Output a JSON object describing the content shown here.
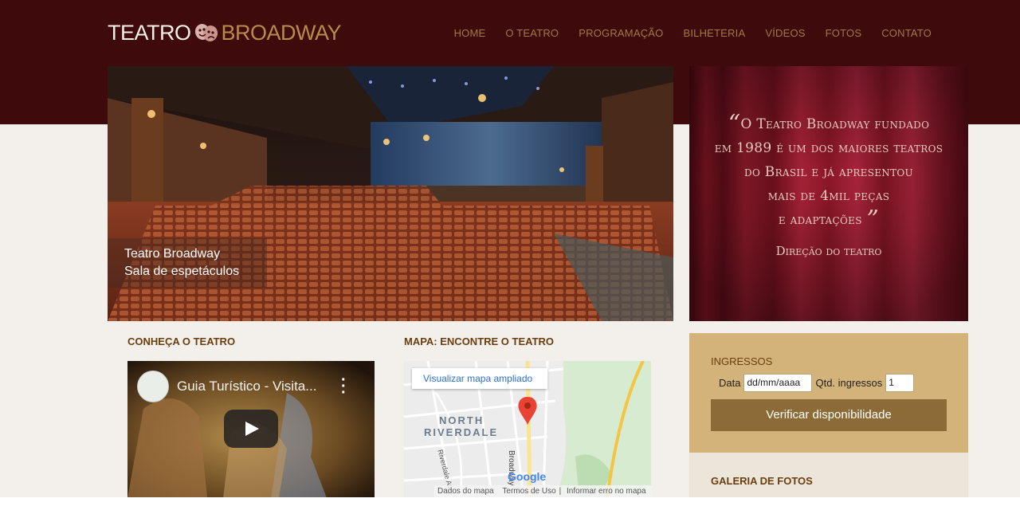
{
  "header": {
    "logo_left": "TEATRO",
    "logo_right": "BROADWAY",
    "nav": [
      "HOME",
      "O TEATRO",
      "PROGRAMAÇÃO",
      "BILHETERIA",
      "VÍDEOS",
      "FOTOS",
      "CONTATO"
    ]
  },
  "hero": {
    "caption_line1": "Teatro Broadway",
    "caption_line2": "Sala de espetáculos"
  },
  "quote": {
    "lines": [
      "O Teatro Broadway fundado",
      "em 1989 é um dos maiores teatros",
      "do Brasil e já apresentou",
      "mais de 4mil peças",
      "e adaptações"
    ],
    "open_mark": "“",
    "close_mark": "”",
    "author": "Direção do teatro"
  },
  "section_video": {
    "heading": "CONHEÇA O TEATRO",
    "video_title": "Guia Turístico - Visita...",
    "menu_icon": "more-vertical-icon",
    "play_icon": "play-icon"
  },
  "section_map": {
    "heading": "MAPA: ENCONTRE O TEATRO",
    "link": "Visualizar mapa ampliado",
    "area_line1": "NORTH",
    "area_line2": "RIVERDALE",
    "street1": "Broadway",
    "street2": "Riverdale Ave",
    "brand": "Google",
    "footer": [
      "Dados do mapa",
      "Termos de Uso",
      "Informar erro no mapa"
    ]
  },
  "tickets": {
    "heading": "INGRESSOS",
    "date_label": "Data",
    "date_placeholder": "dd/mm/aaaa",
    "qty_label": "Qtd. ingressos",
    "qty_value": "1",
    "button": "Verificar disponibilidade"
  },
  "gallery": {
    "heading": "GALERIA DE FOTOS"
  },
  "colors": {
    "header_bg": "#3e0a0c",
    "accent_gold": "#b88b4a",
    "button_bg": "#8c6b36",
    "tickets_bg": "#d4b37a"
  }
}
